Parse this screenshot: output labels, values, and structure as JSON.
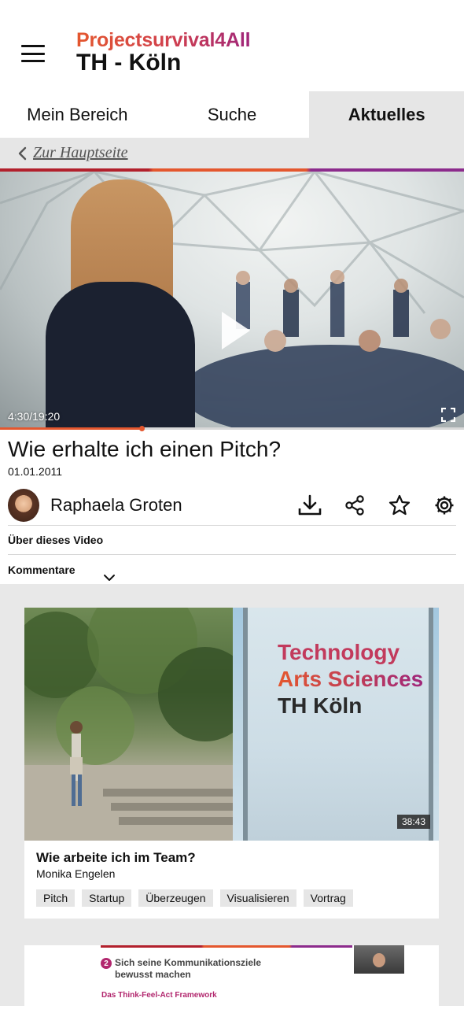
{
  "header": {
    "brand_top": "Projectsurvival4All",
    "brand_bottom": "TH - Köln"
  },
  "tabs": [
    {
      "label": "Mein Bereich",
      "active": false
    },
    {
      "label": "Suche",
      "active": false
    },
    {
      "label": "Aktuelles",
      "active": true
    }
  ],
  "back": {
    "label": "Zur Hauptseite"
  },
  "player": {
    "time": "4:30/19:20",
    "progress": 0.305
  },
  "video": {
    "title": "Wie erhalte ich einen Pitch?",
    "date": "01.01.2011",
    "author": "Raphaela Groten",
    "about_label": "Über dieses Video",
    "comments_label": "Kommentare"
  },
  "actions": [
    "download-icon",
    "share-icon",
    "star-icon",
    "gear-icon"
  ],
  "colors": {
    "accent_orange": "#e4572e",
    "accent_red": "#b2202c",
    "accent_purple": "#8c2b8c",
    "tab_active_bg": "#e6e6e6"
  },
  "feed": [
    {
      "sign_lines": [
        "Technology",
        "Arts Sciences",
        "TH Köln"
      ],
      "duration": "38:43",
      "title": "Wie arbeite ich im Team?",
      "author": "Monika Engelen",
      "tags": [
        "Pitch",
        "Startup",
        "Überzeugen",
        "Visualisieren",
        "Vortrag"
      ]
    },
    {
      "step_number": "2",
      "step_title": "Sich seine Kommunikationsziele bewusst machen",
      "step_subtitle": "Das Think-Feel-Act Framework"
    }
  ]
}
